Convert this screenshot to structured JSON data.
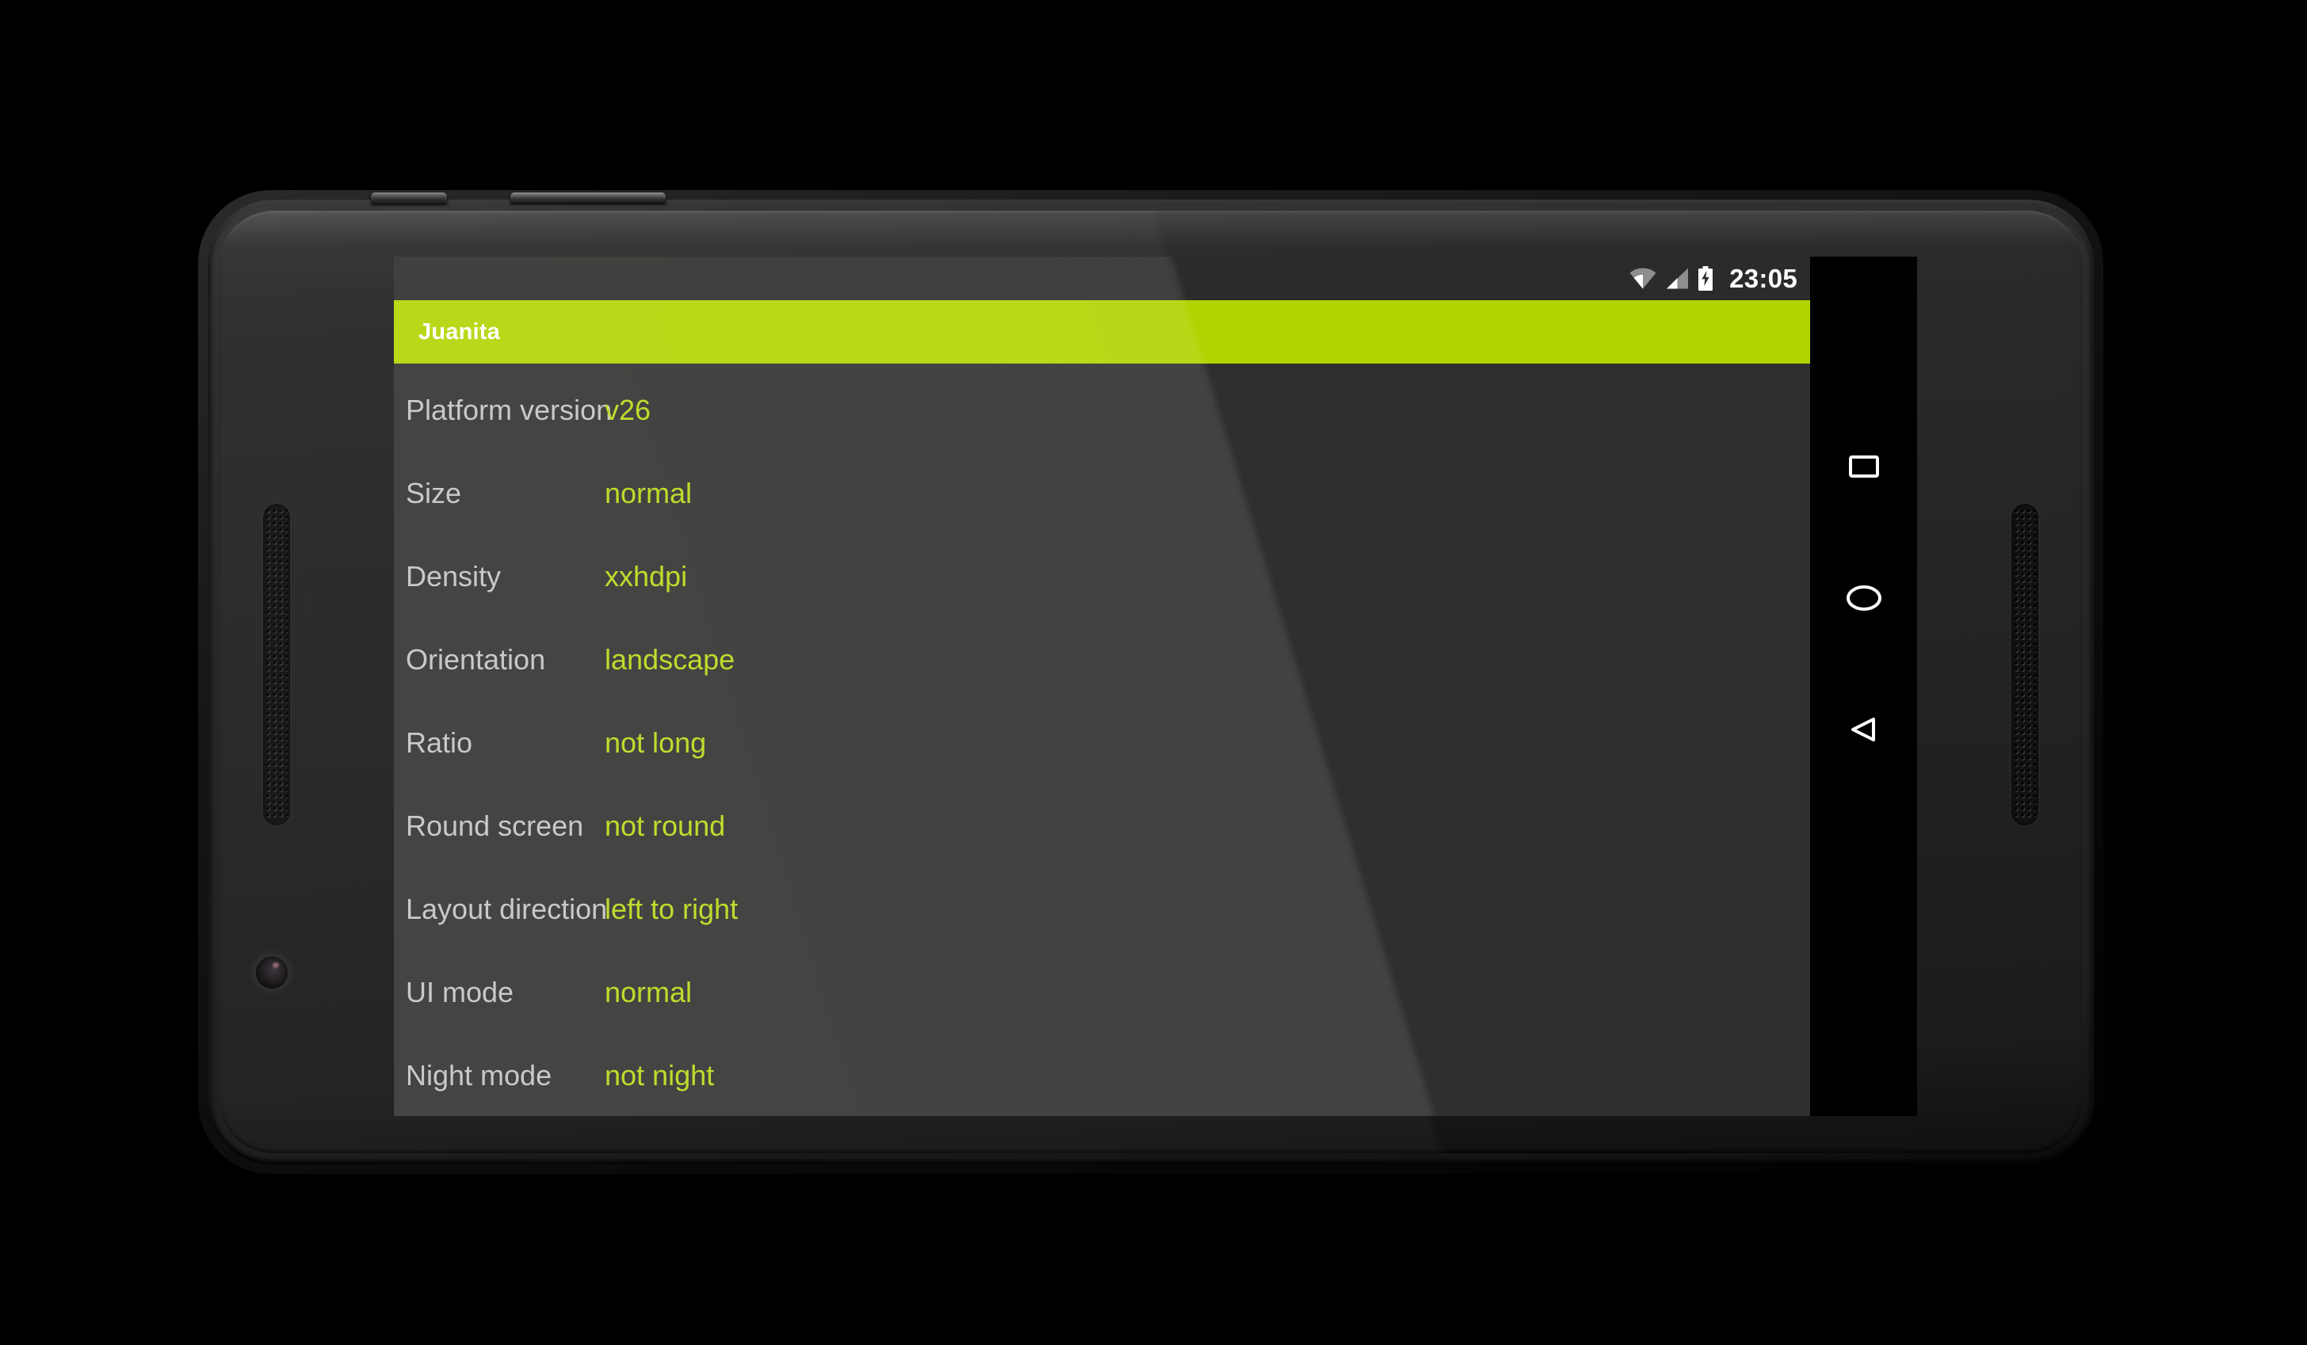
{
  "device": {
    "type": "android-phone-landscape",
    "body_color": "#262626",
    "screen_bg": "#302f2d"
  },
  "status_bar": {
    "background": "#2c2b29",
    "time": "23:05",
    "icons": [
      {
        "name": "wifi-icon",
        "label": "wifi"
      },
      {
        "name": "cellular-signal-icon",
        "label": "signal"
      },
      {
        "name": "battery-charging-icon",
        "label": "battery charging"
      }
    ]
  },
  "action_bar": {
    "title": "Juanita",
    "background": "#b0d400",
    "title_color": "#ffffff"
  },
  "config_list": {
    "label_color": "#c3c3c3",
    "value_color": "#b8d916",
    "rows": [
      {
        "label": "Platform version",
        "value": "v26"
      },
      {
        "label": "Size",
        "value": "normal"
      },
      {
        "label": "Density",
        "value": "xxhdpi"
      },
      {
        "label": "Orientation",
        "value": "landscape"
      },
      {
        "label": "Ratio",
        "value": "not long"
      },
      {
        "label": "Round screen",
        "value": "not round"
      },
      {
        "label": "Layout direction",
        "value": "left to right"
      },
      {
        "label": "UI mode",
        "value": "normal"
      },
      {
        "label": "Night mode",
        "value": "not night"
      }
    ]
  },
  "nav_bar": {
    "background": "#000000",
    "icon_color": "#ffffff",
    "buttons": [
      {
        "name": "recents-button",
        "icon": "square-icon",
        "label": "Recents"
      },
      {
        "name": "home-button",
        "icon": "circle-icon",
        "label": "Home"
      },
      {
        "name": "back-button",
        "icon": "triangle-left-icon",
        "label": "Back"
      }
    ]
  },
  "hardware": {
    "power_button": "power-button",
    "volume_button": "volume-rocker",
    "speaker_left": "speaker-grille-left",
    "speaker_right": "speaker-grille-right",
    "camera": "front-camera"
  }
}
